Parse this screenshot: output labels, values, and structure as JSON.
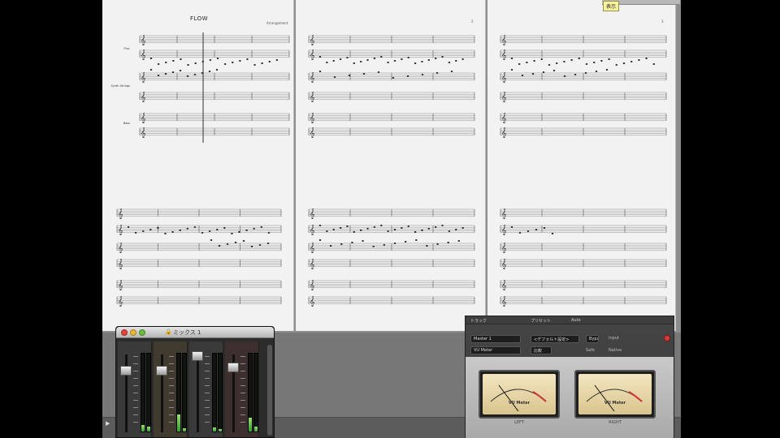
{
  "score": {
    "title": "FLOW",
    "composer": "Arrangement",
    "page2_number": "2",
    "page3_number": "3",
    "instruments": [
      "Pno.",
      "Synth Strings",
      "Bass"
    ]
  },
  "tooltip": {
    "badge": "表示"
  },
  "mixer": {
    "title": "ミックス 1"
  },
  "plugin": {
    "menu": [
      "トラック",
      "プリセット",
      "Auto"
    ],
    "track_select": "Master 1",
    "preset_select": "<デフォルト設定>",
    "plugin_name": "VU Meter",
    "bypass_label": "Bypass",
    "compare_label": "比較",
    "input_label": "Input",
    "safe_label": "Safe",
    "native_label": "Native",
    "vu_left_brand": "VU Meter",
    "vu_right_brand": "VU Meter",
    "left_label": "LEFT",
    "right_label": "RIGHT"
  },
  "colors": {
    "accent_red": "#d83a3a",
    "meter_green": "#2fa02f",
    "vu_face": "#f3e6bf"
  }
}
